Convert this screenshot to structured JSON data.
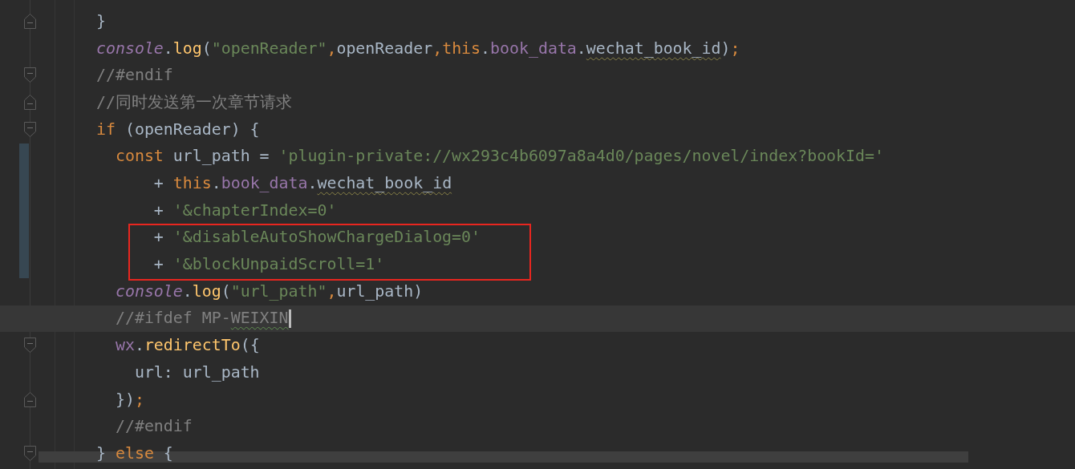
{
  "editor": {
    "lines": [
      {
        "fold_start": false,
        "fold_end": true,
        "changed": false,
        "current": false,
        "boxed": false,
        "caret": false,
        "tokens": [
          {
            "text": "}",
            "kind": "plain"
          }
        ]
      },
      {
        "fold_start": false,
        "fold_end": false,
        "changed": false,
        "current": false,
        "boxed": false,
        "caret": false,
        "tokens": [
          {
            "text": "console",
            "kind": "global"
          },
          {
            "text": ".",
            "kind": "plain"
          },
          {
            "text": "log",
            "kind": "func"
          },
          {
            "text": "(",
            "kind": "plain"
          },
          {
            "text": "\"openReader\"",
            "kind": "string"
          },
          {
            "text": ",",
            "kind": "keyword"
          },
          {
            "text": "openReader",
            "kind": "plain"
          },
          {
            "text": ",",
            "kind": "keyword"
          },
          {
            "text": "this",
            "kind": "keyword"
          },
          {
            "text": ".",
            "kind": "plain"
          },
          {
            "text": "book_data",
            "kind": "field"
          },
          {
            "text": ".",
            "kind": "plain"
          },
          {
            "text": "wechat_book_id",
            "kind": "warning"
          },
          {
            "text": ")",
            "kind": "plain"
          },
          {
            "text": ";",
            "kind": "keyword"
          }
        ]
      },
      {
        "fold_start": true,
        "fold_end": false,
        "changed": false,
        "current": false,
        "boxed": false,
        "caret": false,
        "tokens": [
          {
            "text": "//#endif",
            "kind": "comment"
          }
        ]
      },
      {
        "fold_start": false,
        "fold_end": true,
        "changed": false,
        "current": false,
        "boxed": false,
        "caret": false,
        "tokens": [
          {
            "text": "//同时发送第一次章节请求",
            "kind": "comment"
          }
        ]
      },
      {
        "fold_start": true,
        "fold_end": false,
        "changed": false,
        "current": false,
        "boxed": false,
        "caret": false,
        "tokens": [
          {
            "text": "if",
            "kind": "keyword"
          },
          {
            "text": " (openReader) {",
            "kind": "plain"
          }
        ]
      },
      {
        "fold_start": false,
        "fold_end": false,
        "changed": true,
        "current": false,
        "boxed": false,
        "caret": false,
        "tokens": [
          {
            "text": "  const",
            "kind": "keyword"
          },
          {
            "text": " url_path = ",
            "kind": "plain"
          },
          {
            "text": "'plugin-private://wx293c4b6097a8a4d0/pages/novel/index?bookId='",
            "kind": "string"
          }
        ]
      },
      {
        "fold_start": false,
        "fold_end": false,
        "changed": true,
        "current": false,
        "boxed": false,
        "caret": false,
        "tokens": [
          {
            "text": "      + ",
            "kind": "plain"
          },
          {
            "text": "this",
            "kind": "keyword"
          },
          {
            "text": ".",
            "kind": "plain"
          },
          {
            "text": "book_data",
            "kind": "field"
          },
          {
            "text": ".",
            "kind": "plain"
          },
          {
            "text": "wechat_book_id",
            "kind": "warning"
          }
        ]
      },
      {
        "fold_start": false,
        "fold_end": false,
        "changed": true,
        "current": false,
        "boxed": false,
        "caret": false,
        "tokens": [
          {
            "text": "      + ",
            "kind": "plain"
          },
          {
            "text": "'&chapterIndex=0'",
            "kind": "string"
          }
        ]
      },
      {
        "fold_start": false,
        "fold_end": false,
        "changed": true,
        "current": false,
        "boxed": true,
        "caret": false,
        "tokens": [
          {
            "text": "      + ",
            "kind": "plain"
          },
          {
            "text": "'&disableAutoShowChargeDialog=0'",
            "kind": "string"
          }
        ]
      },
      {
        "fold_start": false,
        "fold_end": false,
        "changed": true,
        "current": false,
        "boxed": true,
        "caret": false,
        "tokens": [
          {
            "text": "      + ",
            "kind": "plain"
          },
          {
            "text": "'&blockUnpaidScroll=1'",
            "kind": "string"
          }
        ]
      },
      {
        "fold_start": false,
        "fold_end": false,
        "changed": false,
        "current": false,
        "boxed": false,
        "caret": false,
        "tokens": [
          {
            "text": "  console",
            "kind": "global"
          },
          {
            "text": ".",
            "kind": "plain"
          },
          {
            "text": "log",
            "kind": "func"
          },
          {
            "text": "(",
            "kind": "plain"
          },
          {
            "text": "\"url_path\"",
            "kind": "string"
          },
          {
            "text": ",",
            "kind": "keyword"
          },
          {
            "text": "url_path)",
            "kind": "plain"
          }
        ]
      },
      {
        "fold_start": false,
        "fold_end": false,
        "changed": false,
        "current": true,
        "boxed": false,
        "caret": true,
        "tokens": [
          {
            "text": "  //#ifdef MP-",
            "kind": "comment"
          },
          {
            "text": "WEIXIN",
            "kind": "typo"
          }
        ]
      },
      {
        "fold_start": true,
        "fold_end": false,
        "changed": false,
        "current": false,
        "boxed": false,
        "caret": false,
        "tokens": [
          {
            "text": "  wx",
            "kind": "field"
          },
          {
            "text": ".",
            "kind": "plain"
          },
          {
            "text": "redirectTo",
            "kind": "func"
          },
          {
            "text": "({",
            "kind": "plain"
          }
        ]
      },
      {
        "fold_start": false,
        "fold_end": false,
        "changed": false,
        "current": false,
        "boxed": false,
        "caret": false,
        "tokens": [
          {
            "text": "    url: url_path",
            "kind": "plain"
          }
        ]
      },
      {
        "fold_start": false,
        "fold_end": true,
        "changed": false,
        "current": false,
        "boxed": false,
        "caret": false,
        "tokens": [
          {
            "text": "  })",
            "kind": "plain"
          },
          {
            "text": ";",
            "kind": "keyword"
          }
        ]
      },
      {
        "fold_start": false,
        "fold_end": false,
        "changed": false,
        "current": false,
        "boxed": false,
        "caret": false,
        "tokens": [
          {
            "text": "  //#endif",
            "kind": "comment"
          }
        ]
      },
      {
        "fold_start": true,
        "fold_end": false,
        "changed": false,
        "current": false,
        "boxed": false,
        "caret": false,
        "tokens": [
          {
            "text": "} ",
            "kind": "plain"
          },
          {
            "text": "else",
            "kind": "keyword"
          },
          {
            "text": " {",
            "kind": "plain"
          }
        ]
      }
    ]
  }
}
